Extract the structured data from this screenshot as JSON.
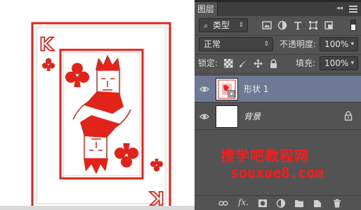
{
  "panel": {
    "tab_label": "图层",
    "filter": {
      "kind_label": "类型",
      "icons": [
        "image-filter-icon",
        "adjustment-filter-icon",
        "type-filter-icon",
        "shape-filter-icon",
        "smart-object-filter-icon"
      ]
    },
    "blend_mode": "正常",
    "opacity_label": "不透明度:",
    "opacity_value": "100%",
    "lock_label": "锁定:",
    "fill_label": "填充:",
    "fill_value": "100%",
    "layers": [
      {
        "name": "形状 1",
        "selected": true,
        "visible": true
      },
      {
        "name": "背景",
        "selected": false,
        "visible": true,
        "locked": true
      }
    ],
    "bottom_icons": [
      "link-layers-icon",
      "fx-icon",
      "add-mask-icon",
      "adjustment-layer-icon",
      "new-group-icon",
      "new-layer-icon",
      "delete-layer-icon"
    ]
  },
  "watermark": {
    "line1": "搜学吧教程网",
    "line2": "souxue8.com"
  },
  "card": {
    "rank": "K",
    "suit_icon": "club-icon",
    "color": "#e2231a"
  }
}
